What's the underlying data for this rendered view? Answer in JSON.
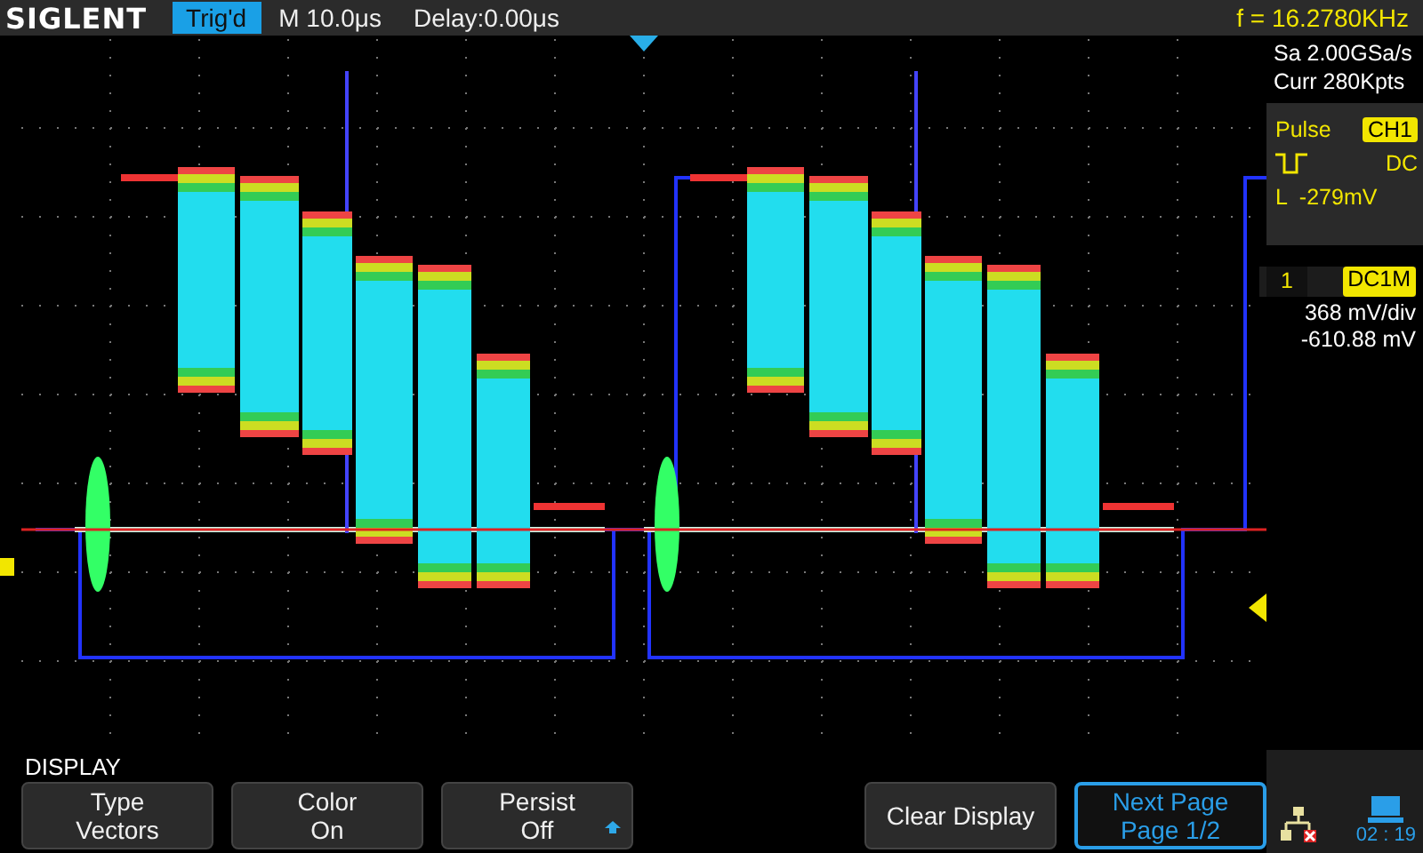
{
  "top_bar": {
    "brand": "SIGLENT",
    "trigger_status": "Trig'd",
    "timebase": "M 10.0μs",
    "delay": "Delay:0.00μs",
    "frequency": "f = 16.2780KHz"
  },
  "acquisition": {
    "sample_rate": "Sa 2.00GSa/s",
    "memory": "Curr 280Kpts"
  },
  "trigger": {
    "type": "Pulse",
    "source": "CH1",
    "coupling": "DC",
    "level": "L  -279mV"
  },
  "channel": {
    "number": "1",
    "coupling": "DC1M",
    "scale": "368 mV/div",
    "offset": "-610.88 mV"
  },
  "menu_title": "DISPLAY",
  "softkeys": [
    {
      "kind": "option",
      "label": "Type",
      "value": "Vectors"
    },
    {
      "kind": "option",
      "label": "Color",
      "value": "On"
    },
    {
      "kind": "option-list",
      "label": "Persist",
      "value": "Off"
    },
    {
      "kind": "action",
      "label": "Clear Display"
    },
    {
      "kind": "page",
      "label": "Next Page",
      "value": "Page 1/2"
    }
  ],
  "status": {
    "time": "02 : 19"
  }
}
